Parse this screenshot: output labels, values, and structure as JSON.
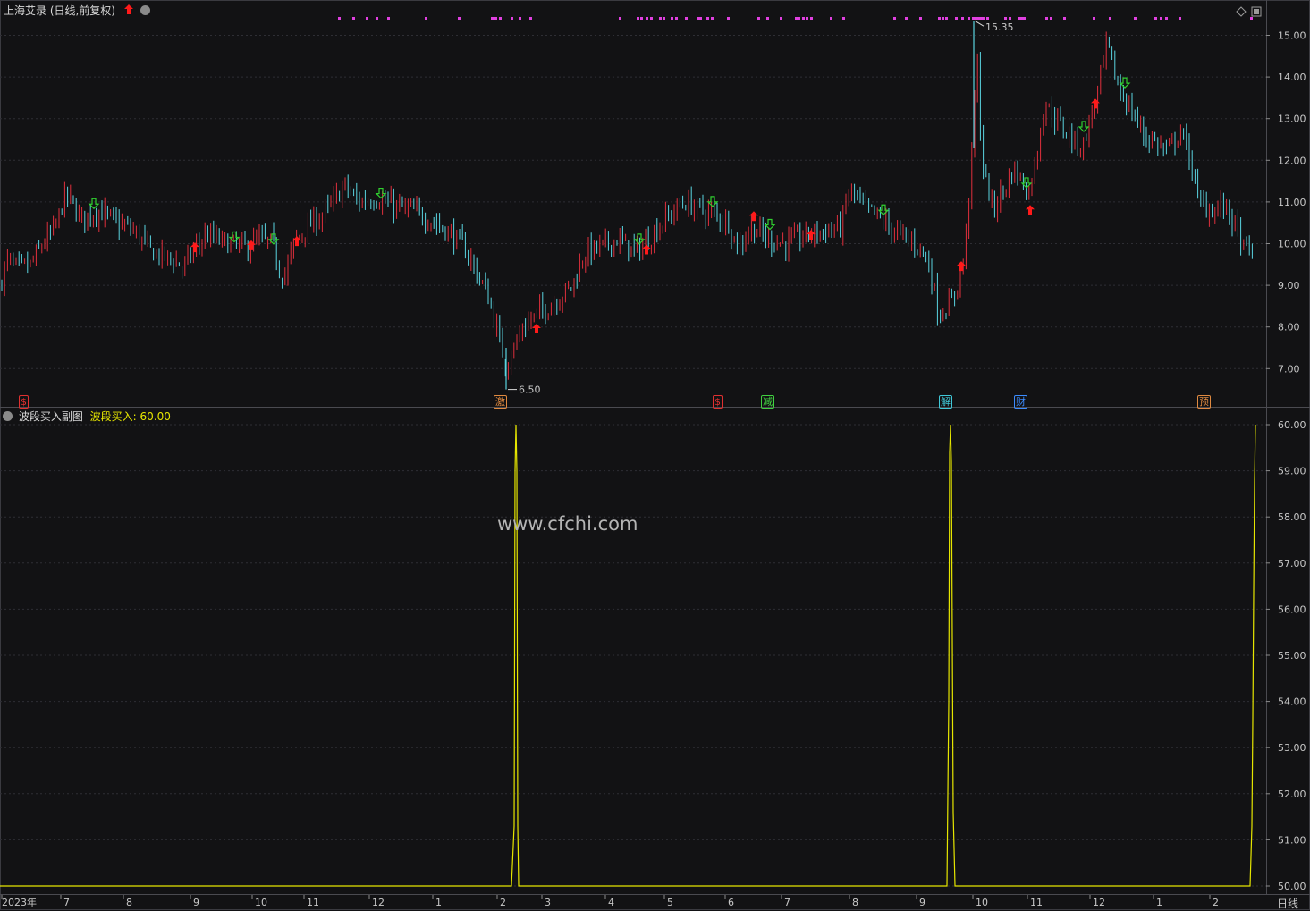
{
  "header": {
    "title": "上海艾录 (日线,前复权)",
    "sub_title": "波段买入副图",
    "sub_value_label": "波段买入:",
    "sub_value": "60.00",
    "period_label": "日线"
  },
  "watermark": "www.cfchi.com",
  "event_badges": [
    {
      "label": "$",
      "color": "#e03030"
    },
    {
      "label": "激",
      "color": "#e08a40"
    },
    {
      "label": "$",
      "color": "#e03030"
    },
    {
      "label": "减",
      "color": "#40d040"
    },
    {
      "label": "解",
      "color": "#40c8d8"
    },
    {
      "label": "财",
      "color": "#3c8cff"
    },
    {
      "label": "预",
      "color": "#e08a40"
    }
  ],
  "colors": {
    "up": "#e0303c",
    "down": "#5ad4e0",
    "signal_line": "#e6e600",
    "buy_arrow": "#ff1a1a",
    "sell_arrow": "#30d030",
    "dots": "#e040e0",
    "grid": "#2e2e34"
  },
  "icons": [
    "dropdown-circle-icon",
    "red-up-arrow-icon",
    "diamond-icon",
    "window-icon"
  ],
  "chart_data": [
    {
      "type": "candlestick",
      "title": "上海艾录 (日线,前复权)",
      "ylim": [
        6.2,
        15.5
      ],
      "y_ticks": [
        "15.00",
        "14.00",
        "13.00",
        "12.00",
        "11.00",
        "10.00",
        "9.00",
        "8.00",
        "7.00"
      ],
      "x_ticks": [
        "2023年",
        "7",
        "8",
        "9",
        "10",
        "11",
        "12",
        "1",
        "2",
        "3",
        "4",
        "5",
        "6",
        "7",
        "8",
        "9",
        "10",
        "11",
        "12",
        "1",
        "2"
      ],
      "annotations": [
        {
          "text": "15.35",
          "kind": "high",
          "value": 15.35
        },
        {
          "text": "6.50",
          "kind": "low",
          "value": 6.5
        }
      ],
      "price_path": [
        [
          0,
          9.0
        ],
        [
          8,
          9.6
        ],
        [
          20,
          9.4
        ],
        [
          35,
          9.5
        ],
        [
          48,
          10.0
        ],
        [
          60,
          10.3
        ],
        [
          74,
          11.2
        ],
        [
          90,
          10.6
        ],
        [
          110,
          10.8
        ],
        [
          130,
          10.5
        ],
        [
          150,
          10.3
        ],
        [
          170,
          9.8
        ],
        [
          195,
          9.6
        ],
        [
          205,
          9.4
        ],
        [
          215,
          9.8
        ],
        [
          230,
          10.2
        ],
        [
          255,
          10.0
        ],
        [
          275,
          9.9
        ],
        [
          290,
          10.1
        ],
        [
          305,
          10.0
        ],
        [
          312,
          9.4
        ],
        [
          318,
          9.2
        ],
        [
          330,
          10.1
        ],
        [
          350,
          10.5
        ],
        [
          370,
          10.9
        ],
        [
          385,
          11.4
        ],
        [
          400,
          11.0
        ],
        [
          420,
          11.1
        ],
        [
          440,
          10.9
        ],
        [
          460,
          10.8
        ],
        [
          480,
          10.6
        ],
        [
          500,
          10.3
        ],
        [
          515,
          10.0
        ],
        [
          525,
          9.7
        ],
        [
          535,
          9.2
        ],
        [
          545,
          8.8
        ],
        [
          555,
          8.0
        ],
        [
          565,
          7.1
        ],
        [
          575,
          7.5
        ],
        [
          585,
          8.0
        ],
        [
          600,
          8.3
        ],
        [
          620,
          8.6
        ],
        [
          640,
          9.0
        ],
        [
          655,
          9.8
        ],
        [
          670,
          9.9
        ],
        [
          690,
          10.1
        ],
        [
          710,
          9.8
        ],
        [
          725,
          10.1
        ],
        [
          745,
          10.6
        ],
        [
          765,
          11.0
        ],
        [
          785,
          10.8
        ],
        [
          800,
          10.7
        ],
        [
          815,
          10.5
        ],
        [
          825,
          9.9
        ],
        [
          840,
          10.4
        ],
        [
          860,
          10.1
        ],
        [
          880,
          10.0
        ],
        [
          900,
          10.2
        ],
        [
          920,
          10.3
        ],
        [
          940,
          10.4
        ],
        [
          950,
          11.3
        ],
        [
          965,
          10.9
        ],
        [
          985,
          10.6
        ],
        [
          1000,
          10.3
        ],
        [
          1015,
          10.1
        ],
        [
          1030,
          9.9
        ],
        [
          1040,
          9.4
        ],
        [
          1050,
          8.3
        ],
        [
          1065,
          8.6
        ],
        [
          1078,
          9.6
        ],
        [
          1088,
          12.4
        ],
        [
          1092,
          14.8
        ],
        [
          1098,
          12.0
        ],
        [
          1110,
          10.8
        ],
        [
          1122,
          11.3
        ],
        [
          1135,
          11.8
        ],
        [
          1150,
          11.2
        ],
        [
          1160,
          12.2
        ],
        [
          1168,
          13.4
        ],
        [
          1180,
          13.0
        ],
        [
          1195,
          12.6
        ],
        [
          1210,
          12.3
        ],
        [
          1225,
          13.4
        ],
        [
          1238,
          14.8
        ],
        [
          1250,
          13.8
        ],
        [
          1265,
          13.2
        ],
        [
          1280,
          12.6
        ],
        [
          1295,
          12.4
        ],
        [
          1305,
          12.2
        ],
        [
          1320,
          12.7
        ],
        [
          1332,
          12.0
        ],
        [
          1340,
          11.0
        ],
        [
          1355,
          10.8
        ],
        [
          1370,
          10.9
        ],
        [
          1380,
          10.5
        ],
        [
          1390,
          9.9
        ],
        [
          1403,
          9.8
        ]
      ],
      "markers": [
        {
          "type": "sell",
          "x": 105,
          "price": 10.95
        },
        {
          "type": "buy",
          "x": 218,
          "price": 9.9
        },
        {
          "type": "sell",
          "x": 262,
          "price": 10.15
        },
        {
          "type": "buy",
          "x": 281,
          "price": 9.95
        },
        {
          "type": "sell",
          "x": 306,
          "price": 10.1
        },
        {
          "type": "buy",
          "x": 332,
          "price": 10.05
        },
        {
          "type": "sell",
          "x": 426,
          "price": 11.2
        },
        {
          "type": "buy",
          "x": 600,
          "price": 7.95
        },
        {
          "type": "sell",
          "x": 715,
          "price": 10.1
        },
        {
          "type": "buy",
          "x": 723,
          "price": 9.85
        },
        {
          "type": "sell",
          "x": 797,
          "price": 11.0
        },
        {
          "type": "buy",
          "x": 843,
          "price": 10.65
        },
        {
          "type": "sell",
          "x": 861,
          "price": 10.45
        },
        {
          "type": "buy",
          "x": 907,
          "price": 10.2
        },
        {
          "type": "sell",
          "x": 988,
          "price": 10.8
        },
        {
          "type": "buy",
          "x": 1075,
          "price": 9.45
        },
        {
          "type": "sell",
          "x": 1148,
          "price": 11.45
        },
        {
          "type": "buy",
          "x": 1152,
          "price": 10.8
        },
        {
          "type": "sell",
          "x": 1212,
          "price": 12.8
        },
        {
          "type": "buy",
          "x": 1225,
          "price": 13.35
        },
        {
          "type": "sell",
          "x": 1258,
          "price": 13.85
        }
      ]
    },
    {
      "type": "line",
      "title": "波段买入副图",
      "series": [
        {
          "name": "波段买入",
          "values": "spikes"
        }
      ],
      "ylim": [
        49.8,
        60.3
      ],
      "y_ticks": [
        "60.00",
        "59.00",
        "58.00",
        "57.00",
        "56.00",
        "55.00",
        "54.00",
        "53.00",
        "52.00",
        "51.00",
        "50.00"
      ],
      "baseline": 50,
      "spikes": [
        {
          "x": [
            572,
            575,
            576,
            577,
            578,
            579,
            580
          ],
          "values": [
            50,
            51.3,
            59.0,
            60.0,
            59.0,
            51.3,
            50
          ]
        },
        {
          "x": [
            1059,
            1061,
            1062,
            1063,
            1064,
            1066,
            1068
          ],
          "values": [
            50,
            54.0,
            59.4,
            60.0,
            59.2,
            51.6,
            50
          ]
        },
        {
          "x": [
            1398,
            1400,
            1401,
            1402,
            1403,
            1404
          ],
          "values": [
            50,
            51.3,
            53.6,
            56.4,
            58.8,
            60.0
          ]
        }
      ]
    }
  ]
}
